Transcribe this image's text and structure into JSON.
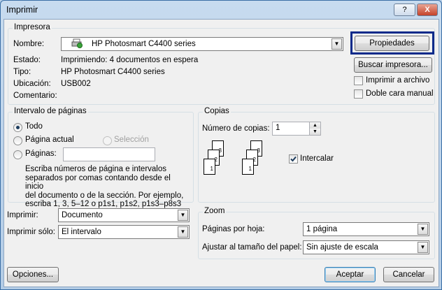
{
  "window": {
    "title": "Imprimir"
  },
  "printer": {
    "group_label": "Impresora",
    "name_label": "Nombre:",
    "name_value": "HP Photosmart C4400 series",
    "status_label": "Estado:",
    "status_value": "Imprimiendo: 4 documentos en espera",
    "type_label": "Tipo:",
    "type_value": "HP Photosmart C4400 series",
    "location_label": "Ubicación:",
    "location_value": "USB002",
    "comment_label": "Comentario:",
    "properties_button": "Propiedades",
    "find_printer_button": "Buscar impresora...",
    "print_to_file_label": "Imprimir a archivo",
    "duplex_label": "Doble cara manual"
  },
  "page_range": {
    "group_label": "Intervalo de páginas",
    "all_label": "Todo",
    "current_page_label": "Página actual",
    "selection_label": "Selección",
    "pages_label": "Páginas:",
    "pages_value": "",
    "help_text": [
      "Escriba números de página e intervalos",
      "separados por comas contando desde el inicio",
      "del documento o de la sección. Por ejemplo,",
      "escriba 1, 3, 5–12 o p1s1, p1s2, p1s3–p8s3"
    ]
  },
  "copies": {
    "group_label": "Copias",
    "count_label": "Número de copias:",
    "count_value": "1",
    "collate_label": "Intercalar",
    "collate_checked": true,
    "stack_labels": [
      "3",
      "2",
      "1"
    ]
  },
  "print_what": {
    "label": "Imprimir:",
    "value": "Documento"
  },
  "print_only": {
    "label": "Imprimir sólo:",
    "value": "El intervalo"
  },
  "zoom": {
    "group_label": "Zoom",
    "pages_per_sheet_label": "Páginas por hoja:",
    "pages_per_sheet_value": "1 página",
    "scale_label": "Ajustar al tamaño del papel:",
    "scale_value": "Sin ajuste de escala"
  },
  "footer": {
    "options_button": "Opciones...",
    "ok_button": "Aceptar",
    "cancel_button": "Cancelar"
  },
  "title_buttons": {
    "help": "?",
    "close": "X"
  }
}
